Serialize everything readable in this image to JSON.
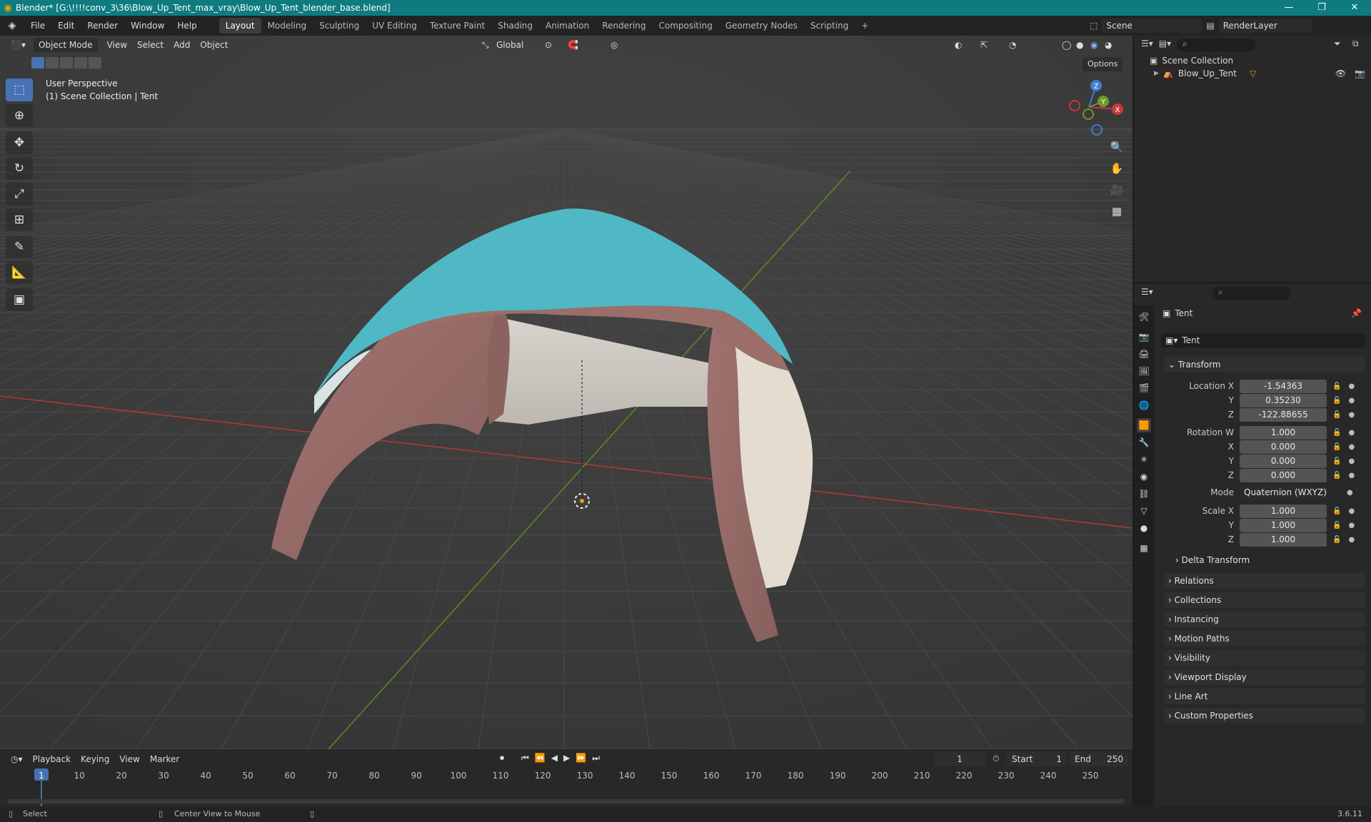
{
  "titlebar": {
    "title": "Blender* [G:\\!!!!conv_3\\36\\Blow_Up_Tent_max_vray\\Blow_Up_Tent_blender_base.blend]",
    "minimize": "—",
    "maximize": "❐",
    "close": "✕"
  },
  "menubar": {
    "items": [
      "File",
      "Edit",
      "Render",
      "Window",
      "Help"
    ],
    "workspaces": [
      "Layout",
      "Modeling",
      "Sculpting",
      "UV Editing",
      "Texture Paint",
      "Shading",
      "Animation",
      "Rendering",
      "Compositing",
      "Geometry Nodes",
      "Scripting"
    ],
    "active_workspace": "Layout",
    "add_workspace": "+",
    "scene": "Scene",
    "render_layer": "RenderLayer"
  },
  "viewport": {
    "mode": "Object Mode",
    "menus": [
      "View",
      "Select",
      "Add",
      "Object"
    ],
    "orientation": "Global",
    "options_label": "Options",
    "overlay_line1": "User Perspective",
    "overlay_line2": "(1) Scene Collection | Tent",
    "gizmo_axes": {
      "x": "X",
      "y": "Y",
      "z": "Z"
    }
  },
  "outliner": {
    "root": "Scene Collection",
    "items": [
      {
        "name": "Blow_Up_Tent"
      }
    ]
  },
  "properties": {
    "object_name": "Tent",
    "object_field": "Tent",
    "transform_label": "Transform",
    "location": {
      "label_x": "Location X",
      "x": "-1.54363",
      "y": "0.35230",
      "z": "-122.88655"
    },
    "rotation": {
      "label_w": "Rotation W",
      "w": "1.000",
      "x": "0.000",
      "y": "0.000",
      "z": "0.000"
    },
    "mode_label": "Mode",
    "mode_value": "Quaternion (WXYZ)",
    "scale": {
      "label_x": "Scale X",
      "x": "1.000",
      "y": "1.000",
      "z": "1.000"
    },
    "axis_labels": {
      "x": "X",
      "y": "Y",
      "z": "Z"
    },
    "delta_transform": "Delta Transform",
    "sections": [
      "Relations",
      "Collections",
      "Instancing",
      "Motion Paths",
      "Visibility",
      "Viewport Display",
      "Line Art",
      "Custom Properties"
    ]
  },
  "timeline": {
    "menus": [
      "Playback",
      "Keying",
      "View",
      "Marker"
    ],
    "current_frame": "1",
    "start_label": "Start",
    "start": "1",
    "end_label": "End",
    "end": "250",
    "ticks": [
      "1",
      "10",
      "20",
      "30",
      "40",
      "50",
      "60",
      "70",
      "80",
      "90",
      "100",
      "110",
      "120",
      "130",
      "140",
      "150",
      "160",
      "170",
      "180",
      "190",
      "200",
      "210",
      "220",
      "230",
      "240",
      "250"
    ]
  },
  "statusbar": {
    "select": "Select",
    "center_view": "Center View to Mouse",
    "version": "3.6.11"
  },
  "colors": {
    "titlebar": "#0e7b80",
    "accent": "#4772b3",
    "tent_top": "#4fb8c4",
    "tent_frame": "#9a6a66",
    "x_axis": "#c8383f",
    "y_axis": "#6c9a2a",
    "z_axis": "#3b7fd4"
  }
}
